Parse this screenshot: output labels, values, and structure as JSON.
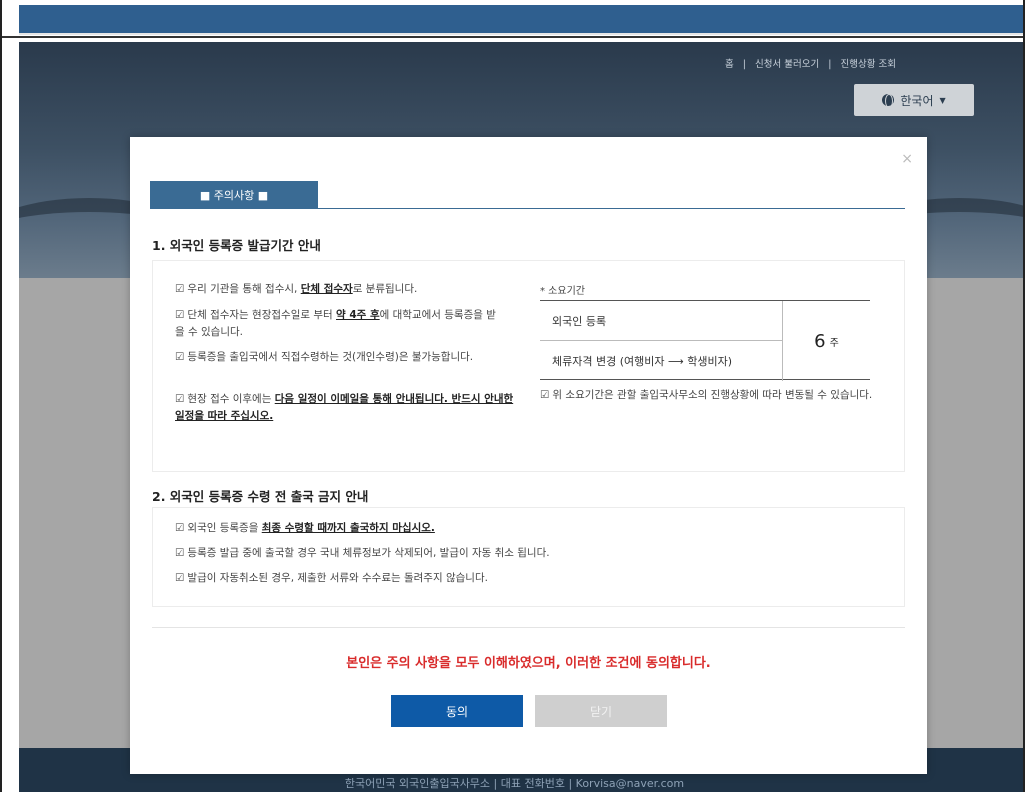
{
  "header": {
    "util_links": [
      "홈",
      "신청서 불러오기",
      "진행상황 조회"
    ],
    "separator": "|",
    "language": "한국어"
  },
  "footer": {
    "text": "한국어민국 외국인출입국사무소 | 대표 전화번호 | Korvisa@naver.com"
  },
  "modal": {
    "close_symbol": "×",
    "tab_label": "■ 주의사항 ■",
    "section1": {
      "title": "1. 외국인 등록증 발급기간 안내",
      "items": [
        {
          "pre": "우리 기관을 통해 접수시, ",
          "em": "단체 접수자",
          "post": "로 분류됩니다."
        },
        {
          "pre": "단체 접수자는 현장접수일로 부터 ",
          "em": "약 4주 후",
          "post": "에 대학교에서 등록증을 받을 수 있습니다."
        },
        {
          "pre": "등록증을 출입국에서 직접수령하는 것(개인수령)은 불가능합니다.",
          "em": "",
          "post": ""
        },
        {
          "pre": "현장 접수 이후에는 ",
          "em": "다음 일정이 이메일을 통해 안내됩니다. 반드시 안내한 일정을 따라 주십시오.",
          "post": ""
        }
      ],
      "duration": {
        "label": "* 소요기간",
        "rows": [
          "외국인 등록",
          "체류자격 변경 (여행비자 ⟶ 학생비자)"
        ],
        "value": "6",
        "unit": "주",
        "note": "위 소요기간은 관할 출입국사무소의 진행상황에 따라 변동될 수 있습니다."
      }
    },
    "section2": {
      "title": "2. 외국인 등록증 수령 전 출국 금지 안내",
      "items": [
        {
          "pre": "외국인 등록증을 ",
          "em": "최종 수령할 때까지 출국하지 마십시오.",
          "post": ""
        },
        {
          "pre": "등록증 발급 중에 출국할 경우 국내 체류정보가 삭제되어, 발급이 자동 취소 됩니다.",
          "em": "",
          "post": ""
        },
        {
          "pre": "발급이 자동취소된 경우, 제출한 서류와 수수료는 돌려주지 않습니다.",
          "em": "",
          "post": ""
        }
      ]
    },
    "agree_statement": "본인은 주의 사항을 모두 이해하였으며, 이러한 조건에 동의합니다.",
    "agree_button": "동의",
    "close_button": "닫기"
  },
  "icons": {
    "check": "☑"
  },
  "colors": {
    "accent": "#0e5aa7",
    "tab": "#3a6b94",
    "warning": "#d92b2b"
  }
}
